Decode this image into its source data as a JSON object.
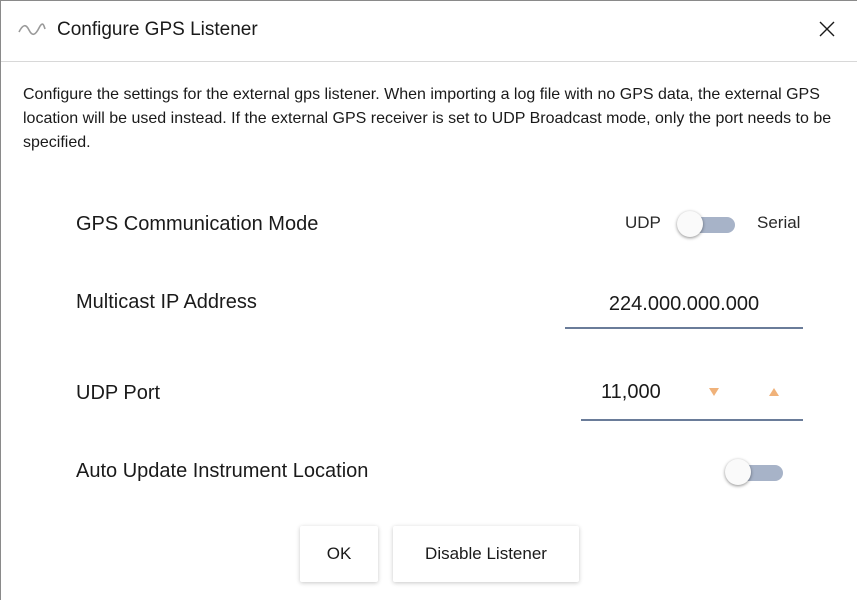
{
  "window": {
    "title": "Configure GPS Listener",
    "close_glyph": "✕",
    "icons": {
      "app": "gps-signal-icon",
      "close": "close-icon"
    }
  },
  "description": "Configure the settings for the external gps listener. When importing a log file with no GPS data, the external GPS location will be used instead. If the external GPS receiver is set to UDP Broadcast mode, only the port needs to be specified.",
  "mode": {
    "label": "GPS Communication Mode",
    "left_option": "UDP",
    "right_option": "Serial",
    "selected": "UDP"
  },
  "multicast": {
    "label": "Multicast IP Address",
    "value": "224.000.000.000"
  },
  "port": {
    "label": "UDP Port",
    "value": "11,000",
    "decrement_glyph": "▼",
    "increment_glyph": "▲"
  },
  "auto_update": {
    "label": "Auto Update Instrument Location",
    "enabled": false
  },
  "buttons": {
    "ok": "OK",
    "disable": "Disable Listener"
  },
  "colors": {
    "accent": "#6a7c99",
    "toggle_track": "#a7b3c8",
    "stepper_arrows": "#f0b27a"
  }
}
